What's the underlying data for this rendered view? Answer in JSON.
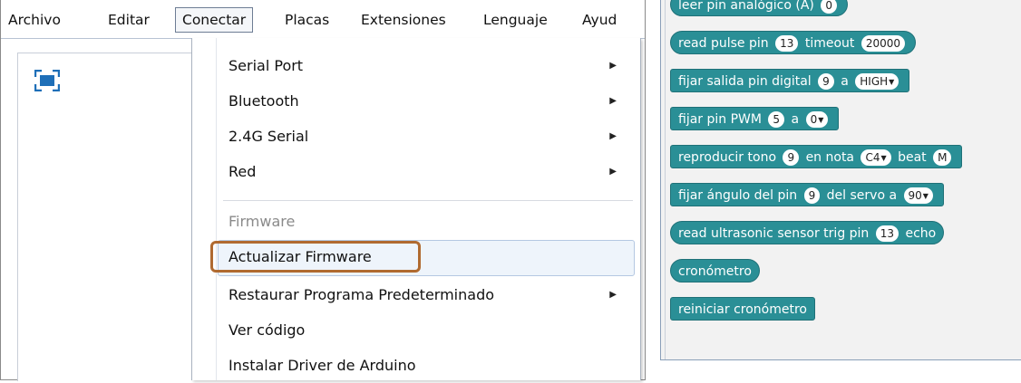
{
  "menubar": {
    "items": [
      "Archivo",
      "Editar",
      "Conectar",
      "Placas",
      "Extensiones",
      "Lenguaje",
      "Ayud"
    ]
  },
  "conectar_menu": {
    "items": [
      {
        "label": "Serial Port",
        "submenu": true
      },
      {
        "label": "Bluetooth",
        "submenu": true
      },
      {
        "label": "2.4G Serial",
        "submenu": true
      },
      {
        "label": "Red",
        "submenu": true
      }
    ],
    "firmware_header": "Firmware",
    "firmware_items": [
      {
        "label": "Actualizar Firmware",
        "submenu": false,
        "highlighted": true
      },
      {
        "label": "Restaurar Programa Predeterminado",
        "submenu": true
      },
      {
        "label": "Ver código",
        "submenu": false
      },
      {
        "label": "Instalar Driver de Arduino",
        "submenu": false
      }
    ],
    "submenu_arrow": "▶",
    "highlight_color": "#b06a30"
  },
  "icons": {
    "fullscreen": "fullscreen-icon",
    "dropdown_arrow": "▼"
  },
  "blocks": {
    "color": "#2a8f96",
    "analog": {
      "label": "leer pin analógico (A)",
      "pin": "0"
    },
    "pulse": {
      "label": "read pulse pin",
      "pin": "13",
      "timeout_label": "timeout",
      "timeout": "20000"
    },
    "digital": {
      "label": "fijar salida pin digital",
      "pin": "9",
      "a": "a",
      "value": "HIGH"
    },
    "pwm": {
      "label": "fijar pin PWM",
      "pin": "5",
      "a": "a",
      "value": "0"
    },
    "tone": {
      "label": "reproducir tono",
      "pin": "9",
      "nota_label": "en nota",
      "note": "C4",
      "beat_label": "beat",
      "beat": "M"
    },
    "servo": {
      "label": "fijar ángulo del pin",
      "pin": "9",
      "servo_label": "del servo a",
      "angle": "90"
    },
    "ultrasonic": {
      "label": "read ultrasonic sensor trig pin",
      "pin": "13",
      "echo_label": "echo"
    },
    "timer": {
      "label": "cronómetro"
    },
    "reset_timer": {
      "label": "reiniciar cronómetro"
    }
  }
}
